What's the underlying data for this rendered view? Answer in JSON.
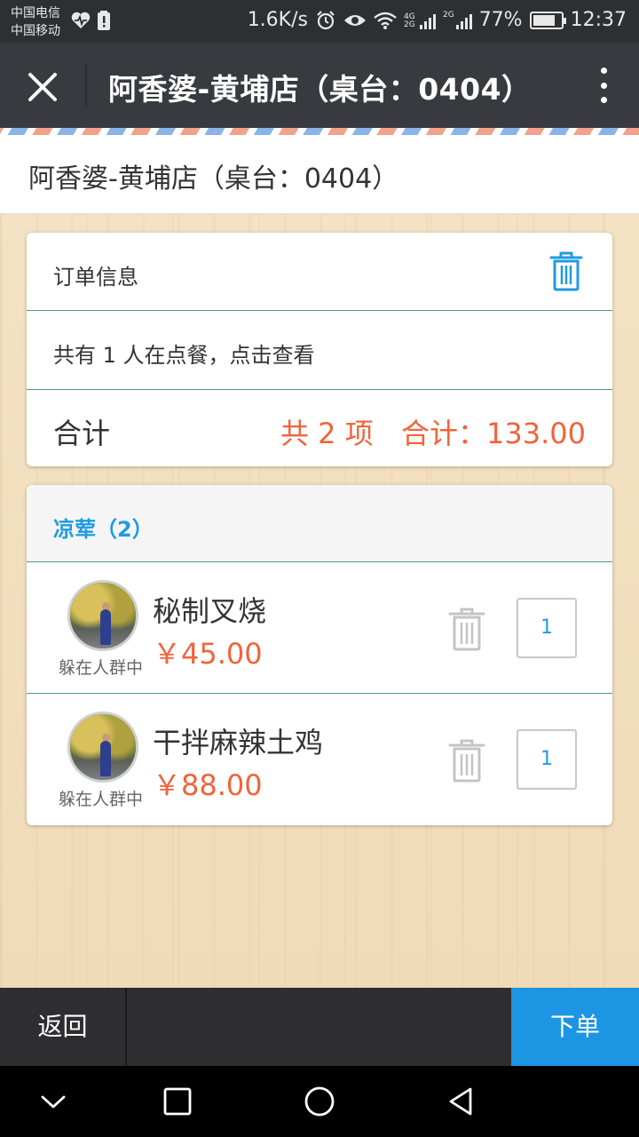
{
  "status_bar": {
    "carrier_1": "中国电信",
    "carrier_2": "中国移动",
    "net_speed": "1.6K/s",
    "network_1": "4G 2G",
    "network_2": "2G",
    "battery": "77%",
    "time": "12:37"
  },
  "title_bar": {
    "title": "阿香婆-黄埔店（桌台：0404）",
    "close_icon": "close-icon",
    "more_icon": "more-vertical-icon"
  },
  "shop_header": {
    "name": "阿香婆-黄埔店（桌台：0404）"
  },
  "order_card": {
    "info_label": "订单信息",
    "diners_text": "共有 1 人在点餐，点击查看",
    "total_label": "合计",
    "item_count": "共 2 项",
    "total_amount": "合计：133.00"
  },
  "category": {
    "label": "凉荤（2）",
    "items": [
      {
        "name": "秘制叉烧",
        "price": "￥45.00",
        "user": "躲在人群中",
        "qty": "1"
      },
      {
        "name": "干拌麻辣土鸡",
        "price": "￥88.00",
        "user": "躲在人群中",
        "qty": "1"
      }
    ]
  },
  "action_bar": {
    "back_label": "返回",
    "order_label": "下单"
  },
  "colors": {
    "accent_blue": "#1c95e3",
    "price_orange": "#f0643b",
    "divider_green": "#4a9d7a",
    "title_bar": "#393a3f"
  }
}
